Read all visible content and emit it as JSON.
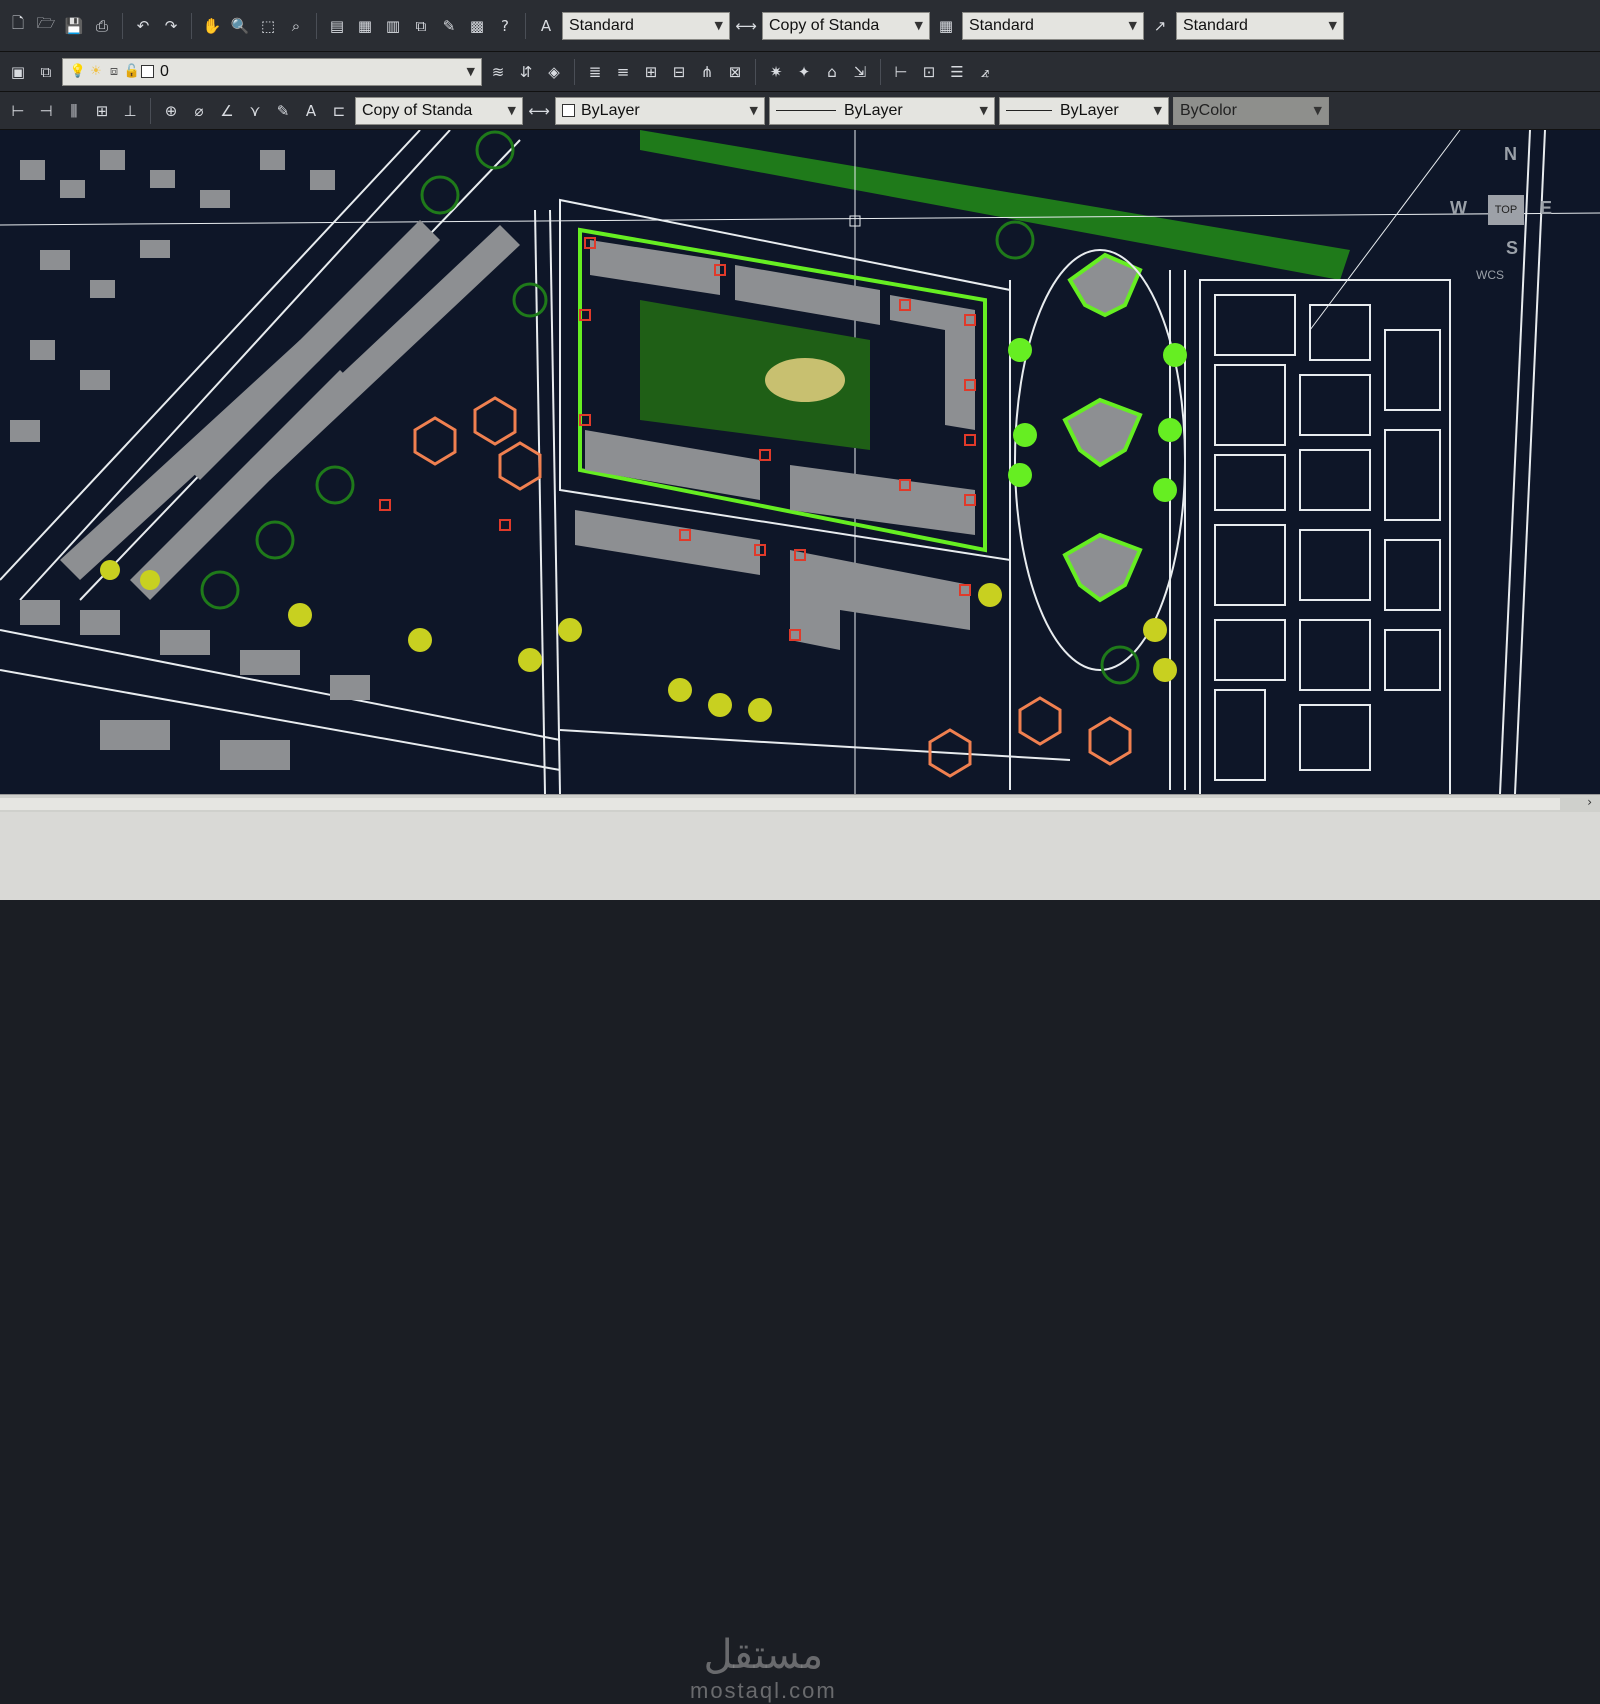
{
  "toolbar1": {
    "text_style": "Standard",
    "dim_style": "Copy of Standa",
    "table_style": "Standard",
    "mleader_style": "Standard"
  },
  "toolbar2": {
    "layer": "0"
  },
  "toolbar3": {
    "dim_style": "Copy of Standa",
    "color": "ByLayer",
    "linetype": "ByLayer",
    "lineweight": "ByLayer",
    "plot_style": "ByColor"
  },
  "viewcube": {
    "north": "N",
    "west": "W",
    "south": "S",
    "east": "E",
    "top": "TOP",
    "wcs": "WCS"
  },
  "watermark": {
    "arabic": "مستقل",
    "latin": "mostaql.com"
  },
  "colors": {
    "canvas": "#0e1628",
    "bright_green": "#66ee22",
    "dark_green": "#1f7a1a",
    "tree_yellow": "#c8d020",
    "marker_red": "#e03a2a",
    "line_white": "#e8ecef",
    "building_grey": "#8d8f92"
  }
}
